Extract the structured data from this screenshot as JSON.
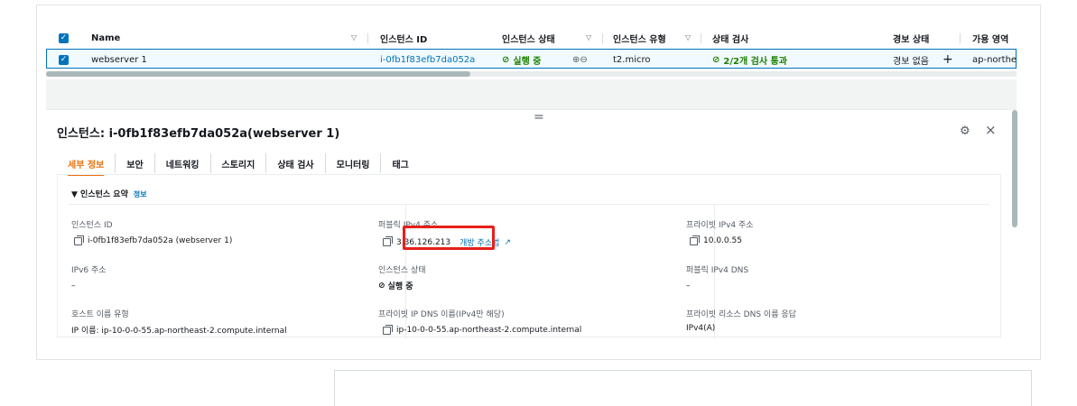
{
  "table": {
    "headers": [
      "Name",
      "인스턴스 ID",
      "인스턴스 상태",
      "인스턴스 유형",
      "상태 검사",
      "경보 상태",
      "가용 영역"
    ],
    "row": {
      "name": "webserver 1",
      "instance_id": "i-0fb1f83efb7da052a",
      "state": "실행 중",
      "zoom": "⊕⊖",
      "type": "t2.micro",
      "status_check": "2/2개 검사 통과",
      "alarm": "경보 없음",
      "add": "+",
      "zone": "ap-northe"
    }
  },
  "panel": {
    "drag_handle": "=",
    "title": "인스턴스: i-0fb1f83efb7da052a(webserver 1)",
    "close": "×",
    "tabs": [
      "세부 정보",
      "보안",
      "네트워킹",
      "스토리지",
      "상태 검사",
      "모니터링",
      "태그"
    ],
    "section": {
      "title": "▼ 인스턴스 요약",
      "info": "정보"
    },
    "fields": {
      "instance_id_label": "인스턴스 ID",
      "instance_id_value": "i-0fb1f83efb7da052a (webserver 1)",
      "public_ip_label": "퍼블릭 IPv4 주소",
      "public_ip_value": "3.36.126.213",
      "open_address_link": "개방 주소법",
      "private_ip_label": "프라이빗 IPv4 주소",
      "private_ip_value": "10.0.0.55",
      "ipv6_label": "IPv6 주소",
      "ipv6_value": "–",
      "state_label": "인스턴스 상태",
      "state_value": "실행 중",
      "public_dns_label": "퍼블릭 IPv4 DNS",
      "public_dns_value": "–",
      "hostname_type_label": "호스트 이름 유형",
      "hostname_type_value": "IP 이름: ip-10-0-0-55.ap-northeast-2.compute.internal",
      "private_dns_label": "프라이빗 IP DNS 이름(IPv4만 해당)",
      "private_dns_value": "ip-10-0-0-55.ap-northeast-2.compute.internal",
      "resource_dns_label": "프라이빗 리소스 DNS 이름 응답",
      "resource_dns_value": "IPv4(A)"
    }
  },
  "colors": {
    "accent": "#0073bb",
    "tab_active": "#ec7211",
    "success": "#1d8102",
    "highlight": "#e6201a"
  }
}
